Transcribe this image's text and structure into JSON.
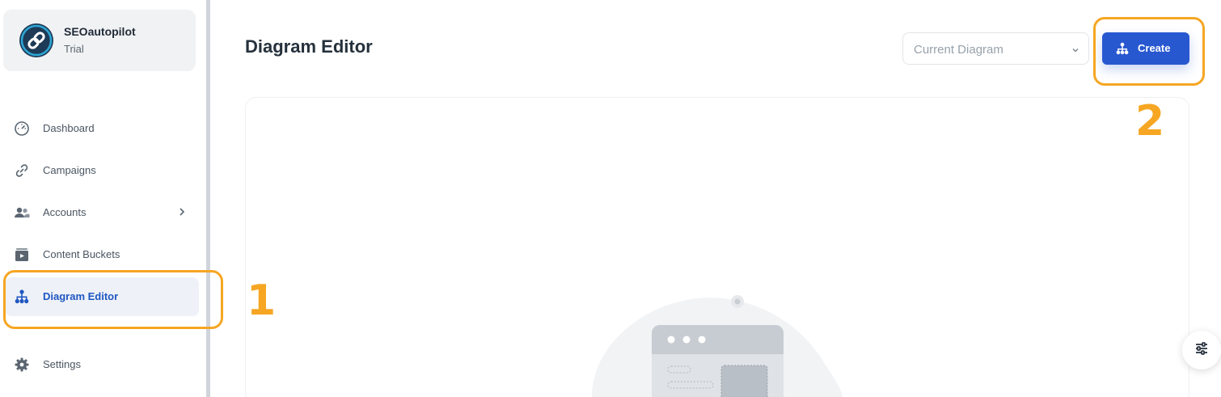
{
  "workspace": {
    "name": "SEOautopilot",
    "plan": "Trial"
  },
  "sidebar": {
    "items": [
      {
        "label": "Dashboard",
        "icon": "speedometer-icon"
      },
      {
        "label": "Campaigns",
        "icon": "link-icon"
      },
      {
        "label": "Accounts",
        "icon": "users-icon",
        "has_submenu": true
      },
      {
        "label": "Content Buckets",
        "icon": "archive-icon"
      },
      {
        "label": "Diagram Editor",
        "icon": "sitemap-icon",
        "active": true
      },
      {
        "label": "Settings",
        "icon": "gear-icon"
      }
    ]
  },
  "header": {
    "title": "Diagram Editor",
    "diagram_select": {
      "value": "Current Diagram",
      "icon": "chevron-down-icon"
    },
    "create_button": {
      "label": "Create",
      "icon": "sitemap-icon"
    }
  },
  "annotations": {
    "step_1": "1",
    "step_2": "2",
    "color": "#f6a623"
  },
  "colors": {
    "accent": "#2858d0",
    "active_nav_text": "#1f57c3",
    "active_nav_bg": "#eef1f7"
  }
}
